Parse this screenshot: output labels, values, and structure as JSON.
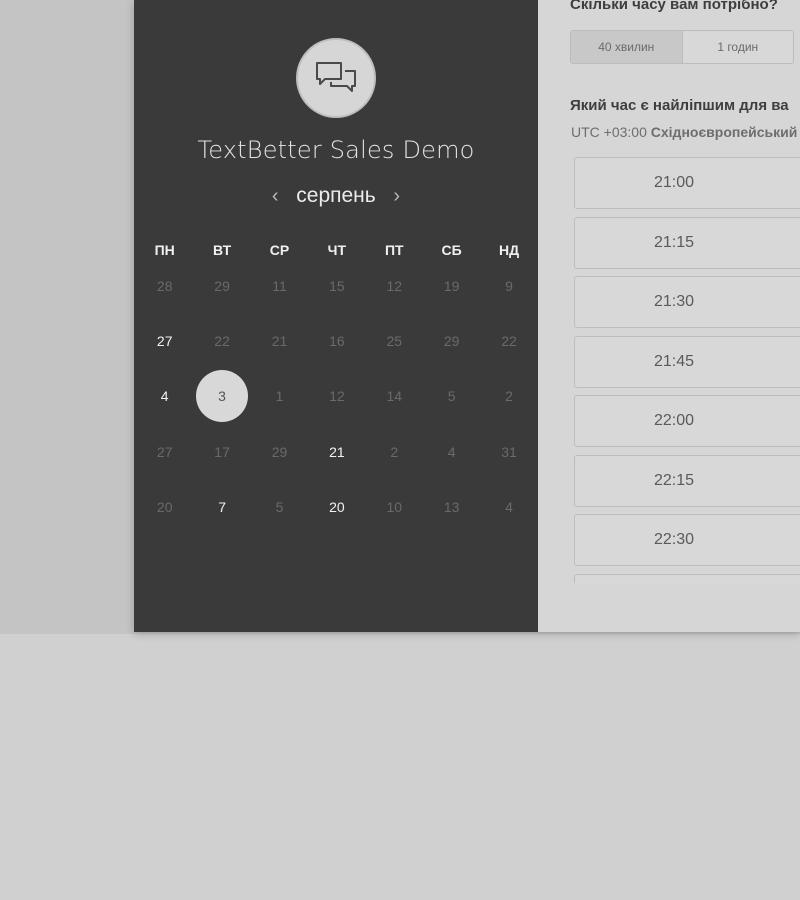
{
  "event": {
    "title": "TextBetter Sales Demo"
  },
  "calendar": {
    "month": "серпень",
    "prev_arrow": "‹",
    "next_arrow": "›",
    "weekdays": [
      "ПН",
      "ВТ",
      "СР",
      "ЧТ",
      "ПТ",
      "СБ",
      "НД"
    ],
    "weeks": [
      [
        "28",
        "29",
        "11",
        "15",
        "12",
        "19",
        "9"
      ],
      [
        "27",
        "22",
        "21",
        "16",
        "25",
        "29",
        "22"
      ],
      [
        "4",
        "3",
        "1",
        "12",
        "14",
        "5",
        "2"
      ],
      [
        "27",
        "17",
        "29",
        "21",
        "2",
        "4",
        "31"
      ],
      [
        "20",
        "7",
        "5",
        "20",
        "10",
        "13",
        "4"
      ]
    ],
    "available": [
      [
        1,
        0
      ],
      [
        2,
        0
      ],
      [
        3,
        3
      ],
      [
        4,
        1
      ],
      [
        4,
        3
      ]
    ],
    "selected": [
      2,
      1
    ]
  },
  "duration": {
    "question": "Скільки часу вам потрібно?",
    "options": [
      "40 хвилин",
      "1 годин"
    ]
  },
  "time": {
    "question": "Який час є найліпшим для ва",
    "timezone_offset": "UTC +03:00",
    "timezone_name": "Східноєвропейський",
    "slots": [
      "21:00",
      "21:15",
      "21:30",
      "21:45",
      "22:00",
      "22:15",
      "22:30",
      ""
    ]
  }
}
